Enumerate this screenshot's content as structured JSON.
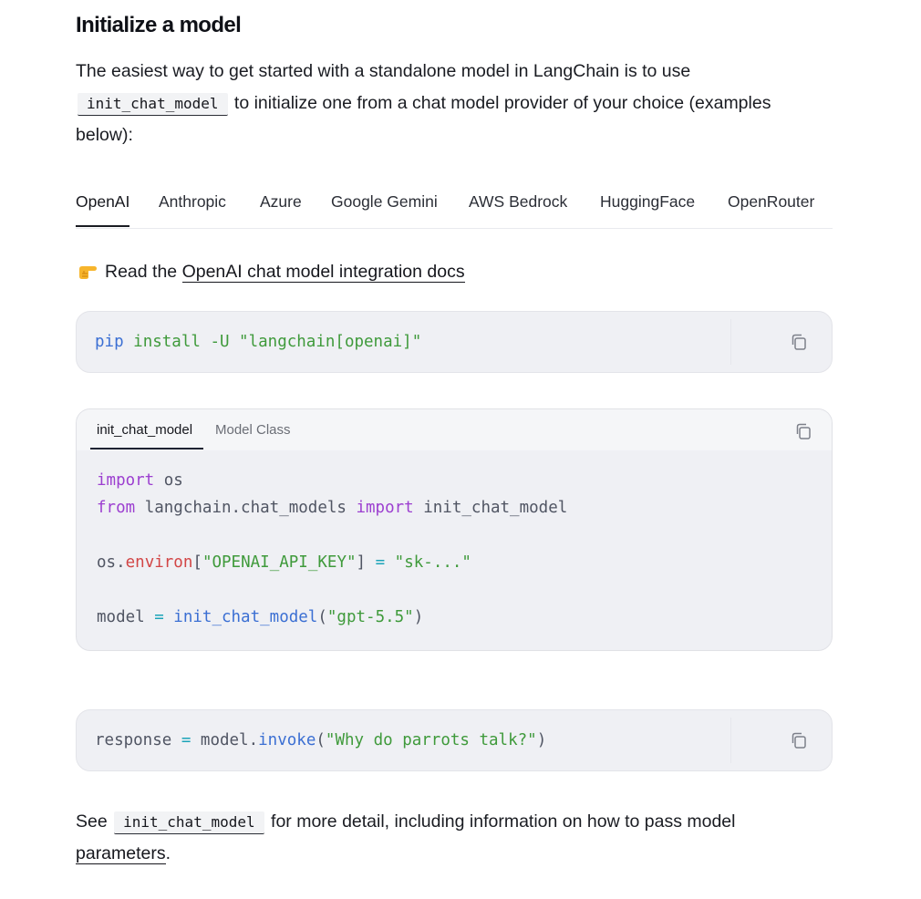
{
  "heading": "Initialize a model",
  "intro": {
    "text_before": "The easiest way to get started with a standalone model in LangChain is to use",
    "code": "init_chat_model",
    "text_after": "to initialize one from a chat model provider of your choice (examples below):"
  },
  "provider_tabs": [
    {
      "label": "OpenAI",
      "active": true
    },
    {
      "label": "Anthropic"
    },
    {
      "label": "Azure"
    },
    {
      "label": "Google Gemini"
    },
    {
      "label": "AWS Bedrock"
    },
    {
      "label": "HuggingFace"
    },
    {
      "label": "OpenRouter"
    }
  ],
  "read_docs": {
    "icon": "pointing-hand-icon",
    "prefix": "Read the",
    "link": "OpenAI chat model integration docs"
  },
  "pip_block": {
    "cmd": "pip",
    "args": "install -U \"langchain[openai]\""
  },
  "code_tabs": [
    {
      "label": "init_chat_model",
      "active": true
    },
    {
      "label": "Model Class"
    }
  ],
  "code": {
    "l1_kw": "import",
    "l1_rest": " os",
    "l2_kw": "from",
    "l2_mod": " langchain.chat_models ",
    "l2_kw2": "import",
    "l2_name": " init_chat_model",
    "l3_os": "os",
    "l3_dot": ".",
    "l3_attr": "environ",
    "l3_lb": "[",
    "l3_key": "\"OPENAI_API_KEY\"",
    "l3_rb": "]",
    "l3_eq": " = ",
    "l3_val": "\"sk-...\"",
    "l4_var": "model",
    "l4_eq": " = ",
    "l4_fn": "init_chat_model",
    "l4_lp": "(",
    "l4_arg": "\"gpt-5.5\"",
    "l4_rp": ")"
  },
  "response_block": {
    "var": "response",
    "eq": " = ",
    "obj": "model",
    "dot": ".",
    "fn": "invoke",
    "lp": "(",
    "arg": "\"Why do parrots talk?\"",
    "rp": ")"
  },
  "footer": {
    "prefix": "See",
    "code": "init_chat_model",
    "middle": "for more detail, including information on how to pass model",
    "link": "parameters",
    "suffix": "."
  },
  "colors": {
    "keyword": "#9c3fd0",
    "function": "#3b6fd3",
    "string": "#3f9a3b",
    "attribute": "#d24545",
    "code_bg": "#eff0f4"
  }
}
